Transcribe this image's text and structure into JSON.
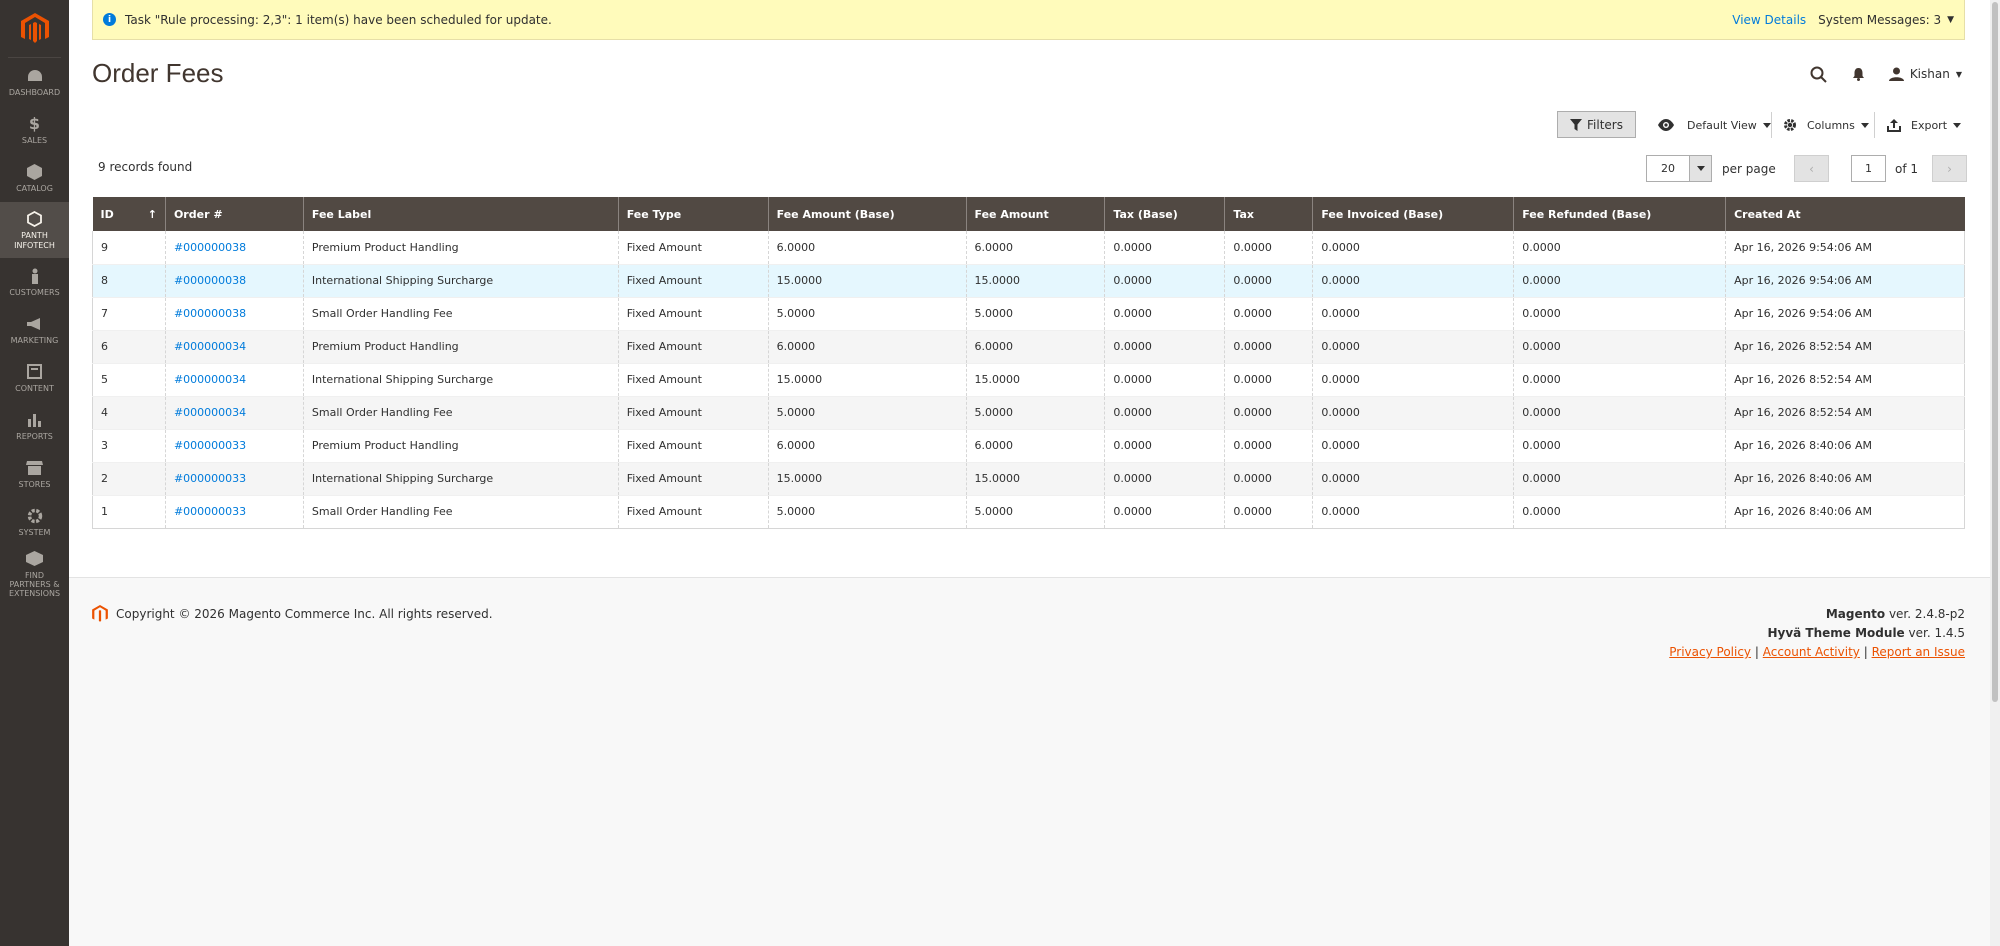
{
  "sidebar": {
    "items": [
      {
        "label": "DASHBOARD",
        "icon": "dashboard-icon"
      },
      {
        "label": "SALES",
        "icon": "dollar-icon"
      },
      {
        "label": "CATALOG",
        "icon": "cube-icon"
      },
      {
        "label": "PANTH INFOTECH",
        "icon": "hexagon-icon",
        "active": true
      },
      {
        "label": "CUSTOMERS",
        "icon": "person-icon"
      },
      {
        "label": "MARKETING",
        "icon": "megaphone-icon"
      },
      {
        "label": "CONTENT",
        "icon": "content-icon"
      },
      {
        "label": "REPORTS",
        "icon": "bar-chart-icon"
      },
      {
        "label": "STORES",
        "icon": "store-icon"
      },
      {
        "label": "SYSTEM",
        "icon": "gear-icon"
      },
      {
        "label": "FIND PARTNERS & EXTENSIONS",
        "icon": "partners-icon"
      }
    ]
  },
  "system_message": {
    "text": "Task \"Rule processing: 2,3\": 1 item(s) have been scheduled for update.",
    "view_details": "View Details",
    "system_messages": "System Messages: 3"
  },
  "header": {
    "title": "Order Fees",
    "user": "Kishan"
  },
  "toolbar": {
    "filters": "Filters",
    "view": "Default View",
    "columns": "Columns",
    "export": "Export"
  },
  "grid": {
    "records": "9 records found",
    "per_page_value": "20",
    "per_page_label": "per page",
    "page_value": "1",
    "page_of": "of 1",
    "columns": [
      "ID",
      "Order #",
      "Fee Label",
      "Fee Type",
      "Fee Amount (Base)",
      "Fee Amount",
      "Tax (Base)",
      "Tax",
      "Fee Invoiced (Base)",
      "Fee Refunded (Base)",
      "Created At"
    ],
    "rows": [
      [
        "9",
        "#000000038",
        "Premium Product Handling",
        "Fixed Amount",
        "6.0000",
        "6.0000",
        "0.0000",
        "0.0000",
        "0.0000",
        "0.0000",
        "Apr 16, 2026 9:54:06 AM"
      ],
      [
        "8",
        "#000000038",
        "International Shipping Surcharge",
        "Fixed Amount",
        "15.0000",
        "15.0000",
        "0.0000",
        "0.0000",
        "0.0000",
        "0.0000",
        "Apr 16, 2026 9:54:06 AM"
      ],
      [
        "7",
        "#000000038",
        "Small Order Handling Fee",
        "Fixed Amount",
        "5.0000",
        "5.0000",
        "0.0000",
        "0.0000",
        "0.0000",
        "0.0000",
        "Apr 16, 2026 9:54:06 AM"
      ],
      [
        "6",
        "#000000034",
        "Premium Product Handling",
        "Fixed Amount",
        "6.0000",
        "6.0000",
        "0.0000",
        "0.0000",
        "0.0000",
        "0.0000",
        "Apr 16, 2026 8:52:54 AM"
      ],
      [
        "5",
        "#000000034",
        "International Shipping Surcharge",
        "Fixed Amount",
        "15.0000",
        "15.0000",
        "0.0000",
        "0.0000",
        "0.0000",
        "0.0000",
        "Apr 16, 2026 8:52:54 AM"
      ],
      [
        "4",
        "#000000034",
        "Small Order Handling Fee",
        "Fixed Amount",
        "5.0000",
        "5.0000",
        "0.0000",
        "0.0000",
        "0.0000",
        "0.0000",
        "Apr 16, 2026 8:52:54 AM"
      ],
      [
        "3",
        "#000000033",
        "Premium Product Handling",
        "Fixed Amount",
        "6.0000",
        "6.0000",
        "0.0000",
        "0.0000",
        "0.0000",
        "0.0000",
        "Apr 16, 2026 8:40:06 AM"
      ],
      [
        "2",
        "#000000033",
        "International Shipping Surcharge",
        "Fixed Amount",
        "15.0000",
        "15.0000",
        "0.0000",
        "0.0000",
        "0.0000",
        "0.0000",
        "Apr 16, 2026 8:40:06 AM"
      ],
      [
        "1",
        "#000000033",
        "Small Order Handling Fee",
        "Fixed Amount",
        "5.0000",
        "5.0000",
        "0.0000",
        "0.0000",
        "0.0000",
        "0.0000",
        "Apr 16, 2026 8:40:06 AM"
      ]
    ]
  },
  "footer": {
    "copyright": "Copyright © 2026 Magento Commerce Inc. All rights reserved.",
    "magento_name": "Magento",
    "magento_ver": " ver. 2.4.8-p2",
    "hyva_name": "Hyvä Theme Module",
    "hyva_ver": " ver. 1.4.5",
    "privacy": "Privacy Policy",
    "account_activity": "Account Activity",
    "report_issue": "Report an Issue",
    "separator": "|"
  },
  "colors": {
    "accent": "#eb5202",
    "link": "#007bdb",
    "sidebar": "#373330",
    "table_header": "#514943"
  }
}
